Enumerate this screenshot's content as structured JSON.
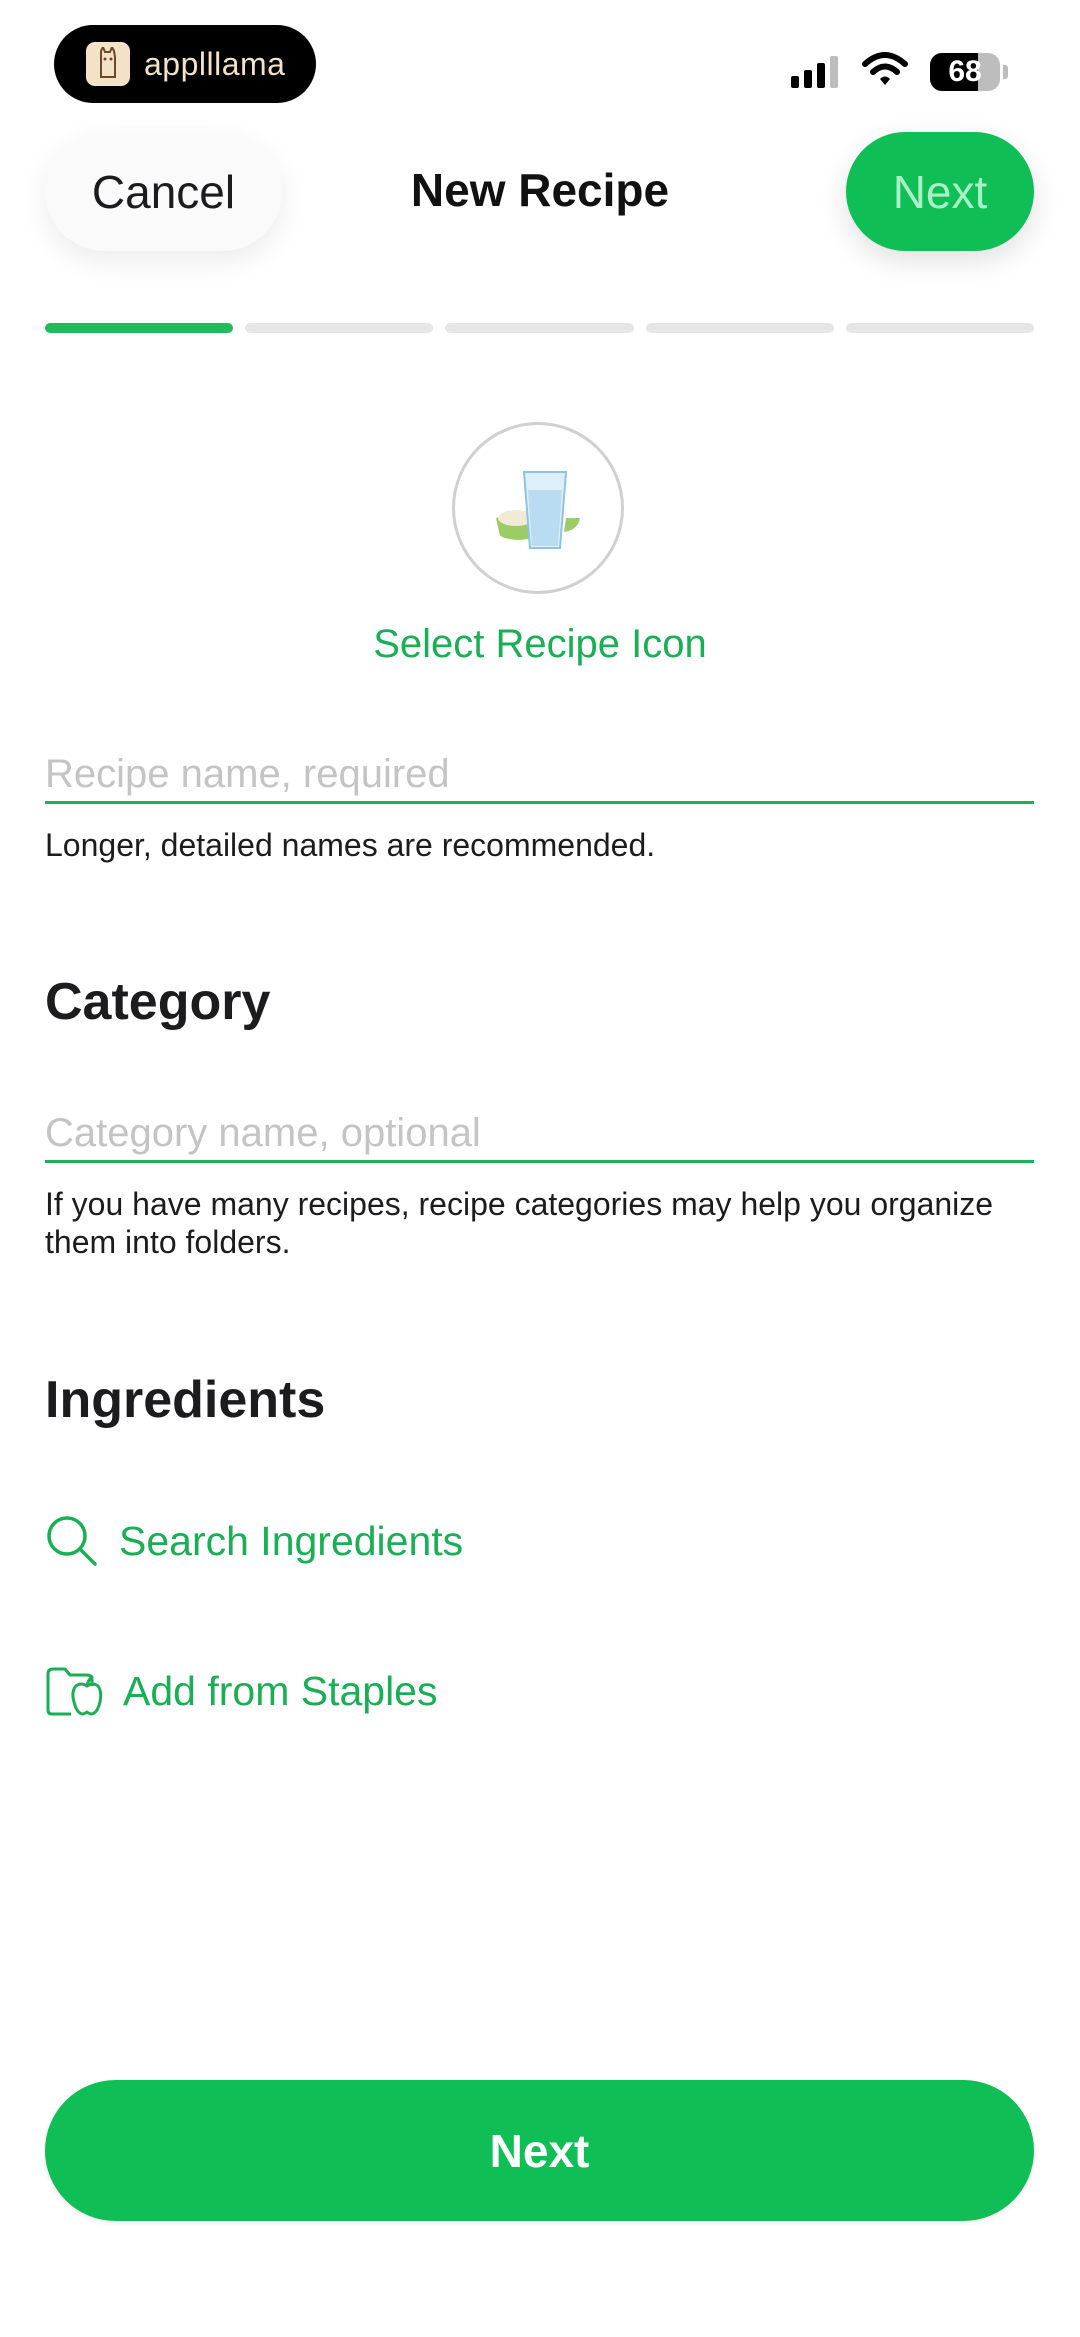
{
  "status_bar": {
    "app_badge": "applllama",
    "battery_level": "68",
    "battery_fraction": 0.68,
    "icons": [
      "llama-logo-icon",
      "cellular-signal-icon",
      "wifi-icon",
      "battery-icon"
    ]
  },
  "nav": {
    "cancel_label": "Cancel",
    "title": "New Recipe",
    "next_label": "Next"
  },
  "progress": {
    "total_steps": 5,
    "current_step": 1
  },
  "recipe_icon": {
    "select_label": "Select Recipe Icon",
    "icon": "glass-and-bowl-icon"
  },
  "recipe_name": {
    "placeholder": "Recipe name, required",
    "value": "",
    "helper": "Longer, detailed names are recommended."
  },
  "category": {
    "section_title": "Category",
    "placeholder": "Category name, optional",
    "value": "",
    "helper": "If you have many recipes, recipe categories may help you organize them into folders."
  },
  "ingredients": {
    "section_title": "Ingredients",
    "search_label": "Search Ingredients",
    "search_icon": "search-icon",
    "staples_label": "Add from Staples",
    "staples_icon": "folder-apple-icon"
  },
  "footer": {
    "next_label": "Next"
  },
  "colors": {
    "accent": "#0fbf55",
    "accent_text": "#1aaf55",
    "progress_active": "#22bb5b",
    "progress_inactive": "#e6e6e6"
  }
}
